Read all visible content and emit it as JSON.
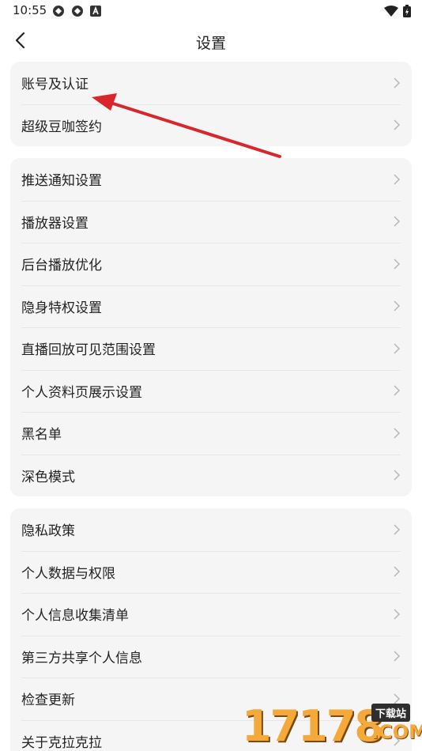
{
  "status_bar": {
    "time": "10:55",
    "left_icons": [
      "sync-icon",
      "sync-icon",
      "a-badge-icon"
    ],
    "right_icons": [
      "wifi-icon",
      "battery-icon"
    ]
  },
  "header": {
    "title": "设置",
    "back_icon": "chevron-left-icon"
  },
  "groups": [
    {
      "items": [
        {
          "label": "账号及认证"
        },
        {
          "label": "超级豆咖签约"
        }
      ]
    },
    {
      "items": [
        {
          "label": "推送通知设置"
        },
        {
          "label": "播放器设置"
        },
        {
          "label": "后台播放优化"
        },
        {
          "label": "隐身特权设置"
        },
        {
          "label": "直播回放可见范围设置"
        },
        {
          "label": "个人资料页展示设置"
        },
        {
          "label": "黑名单"
        },
        {
          "label": "深色模式"
        }
      ]
    },
    {
      "items": [
        {
          "label": "隐私政策"
        },
        {
          "label": "个人数据与权限"
        },
        {
          "label": "个人信息收集清单"
        },
        {
          "label": "第三方共享个人信息"
        },
        {
          "label": "检查更新"
        },
        {
          "label": "关于克拉克拉"
        }
      ]
    }
  ],
  "colors": {
    "card_bg": "#f5f5f5",
    "annotation_arrow": "#d8262a",
    "watermark": "#f4a93a"
  },
  "watermark": {
    "digits": "17178",
    "badge": "下载站",
    "com": ".COM"
  }
}
